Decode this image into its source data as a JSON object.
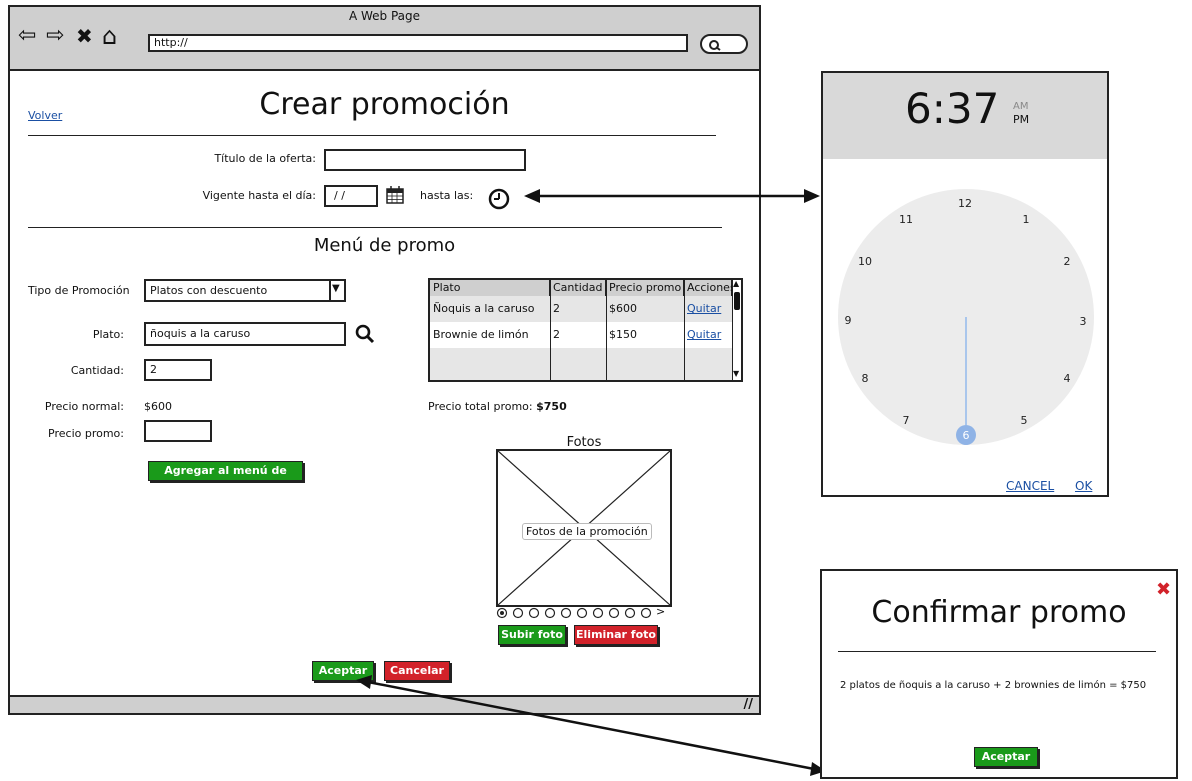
{
  "window": {
    "title": "A Web Page",
    "url": "http://",
    "nav_back": "⇦",
    "nav_forward": "⇨",
    "nav_stop": "✖",
    "nav_home": "⌂"
  },
  "page": {
    "back_link": "Volver",
    "title": "Crear promoción",
    "offer_title_label": "Título de la oferta:",
    "offer_title_value": "",
    "valid_until_label": "Vigente hasta el día:",
    "date_value": "/ /",
    "until_time_label": "hasta las:",
    "menu_section_title": "Menú de promo",
    "promo_type_label": "Tipo de Promoción",
    "promo_type_value": "Platos con descuento",
    "dish_label": "Plato:",
    "dish_value": "ñoquis a la caruso",
    "quantity_label": "Cantidad:",
    "quantity_value": "2",
    "normal_price_label": "Precio normal:",
    "normal_price_value": "$600",
    "promo_price_label": "Precio promo:",
    "promo_price_value": "",
    "add_to_menu_button": "Agregar al menú de promo",
    "total_label": "Precio total promo:",
    "total_value": "$750",
    "photos_title": "Fotos",
    "photos_placeholder": "Fotos de la promoción",
    "carousel_next": ">",
    "upload_photo_button": "Subir foto",
    "delete_photo_button": "Eliminar foto",
    "accept_button": "Aceptar",
    "cancel_button": "Cancelar"
  },
  "table": {
    "headers": [
      "Plato",
      "Cantidad",
      "Precio promo",
      "Acciones"
    ],
    "rows": [
      {
        "plato": "Ñoquis a la caruso",
        "cantidad": "2",
        "precio": "$600",
        "accion": "Quitar"
      },
      {
        "plato": "Brownie de limón",
        "cantidad": "2",
        "precio": "$150",
        "accion": "Quitar"
      }
    ]
  },
  "clock": {
    "time": "6:37",
    "am": "AM",
    "pm": "PM",
    "numbers": [
      "12",
      "1",
      "2",
      "3",
      "4",
      "5",
      "6",
      "7",
      "8",
      "9",
      "10",
      "11"
    ],
    "cancel": "CANCEL",
    "ok": "OK"
  },
  "confirm": {
    "title": "Confirmar promo",
    "close": "✖",
    "message": "2 platos de ñoquis a la caruso + 2 brownies de limón = $750",
    "accept_button": "Aceptar"
  },
  "colors": {
    "green": "#1a9a1a",
    "red": "#d2222a",
    "link": "#1a4fa3",
    "clock_hand": "#a9c6ec",
    "clock_selected": "#8fb3e6"
  }
}
